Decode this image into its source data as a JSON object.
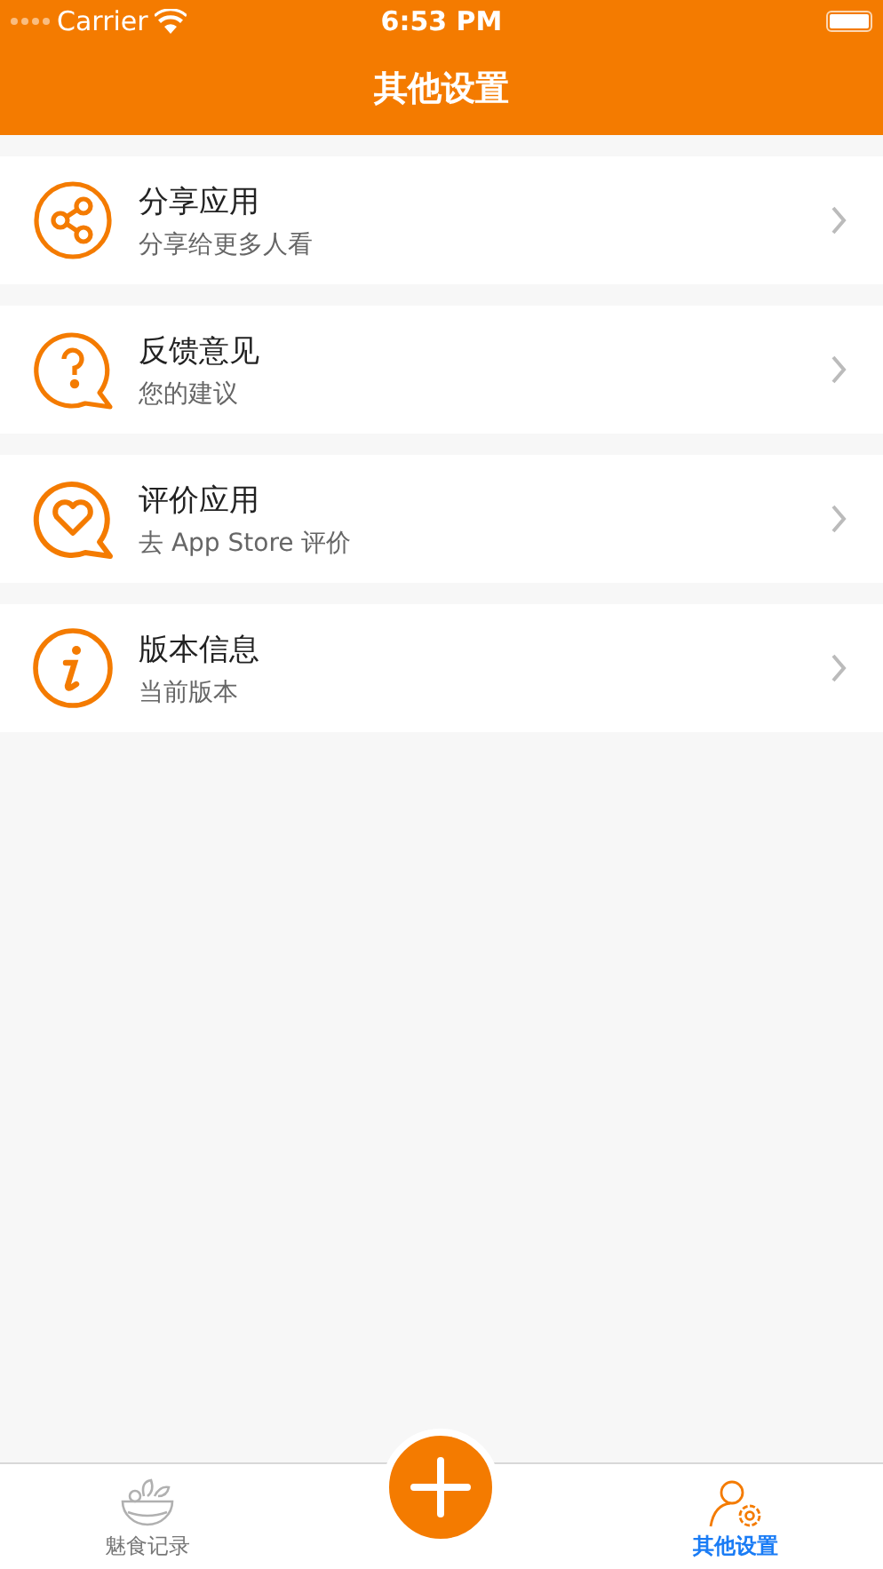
{
  "status_bar": {
    "carrier": "Carrier",
    "time": "6:53 PM"
  },
  "nav_bar": {
    "title": "其他设置"
  },
  "items": [
    {
      "kind": "share",
      "title": "分享应用",
      "subtitle": "分享给更多人看"
    },
    {
      "kind": "question",
      "title": "反馈意见",
      "subtitle": "您的建议"
    },
    {
      "kind": "heart",
      "title": "评价应用",
      "subtitle": "去 App Store 评价"
    },
    {
      "kind": "info",
      "title": "版本信息",
      "subtitle": "当前版本"
    }
  ],
  "tab_bar": {
    "tabs": [
      {
        "kind": "bowl",
        "label": "魅食记录",
        "selected": false
      },
      {
        "kind": "add"
      },
      {
        "kind": "person-gear",
        "label": "其他设置",
        "selected": true
      }
    ]
  }
}
